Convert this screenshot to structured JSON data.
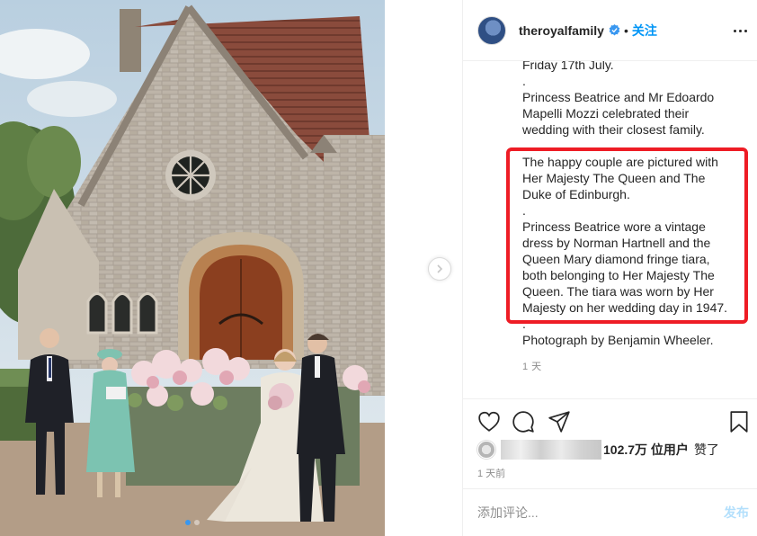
{
  "post": {
    "account": {
      "username": "theroyalfamily",
      "verified": true,
      "follow_label": "关注",
      "separator": "•"
    },
    "caption_lines": [
      "Friday 17th July.",
      ".",
      "Princess Beatrice and Mr Edoardo",
      "Mapelli Mozzi celebrated their",
      "wedding with their closest family.",
      "",
      "The happy couple are pictured with",
      "Her Majesty The Queen and The",
      "Duke of Edinburgh.",
      ".",
      "Princess Beatrice wore a vintage",
      "dress by Norman Hartnell and the",
      "Queen Mary diamond fringe tiara,",
      "both belonging to Her Majesty The",
      "Queen. The tiara was worn by Her",
      "Majesty on her wedding day in 1947.",
      ".",
      "Photograph by Benjamin Wheeler."
    ],
    "caption_time": "1 天",
    "likes": {
      "count_text": "102.7万 位用户",
      "suffix": "赞了"
    },
    "date": "1 天前",
    "comment": {
      "placeholder": "添加评论...",
      "post_label": "发布"
    },
    "carousel": {
      "count": 2,
      "active_index": 0
    }
  },
  "icons": {
    "verified": "verified-badge-icon",
    "more": "more-options-icon",
    "next": "chevron-right-icon",
    "like": "heart-icon",
    "comment": "comment-icon",
    "share": "paper-plane-icon",
    "save": "bookmark-icon"
  },
  "colors": {
    "accent": "#0095f6",
    "highlight_box": "#ee1c25",
    "muted_text": "#8e8e8e",
    "carousel_active": "#3897f0"
  }
}
